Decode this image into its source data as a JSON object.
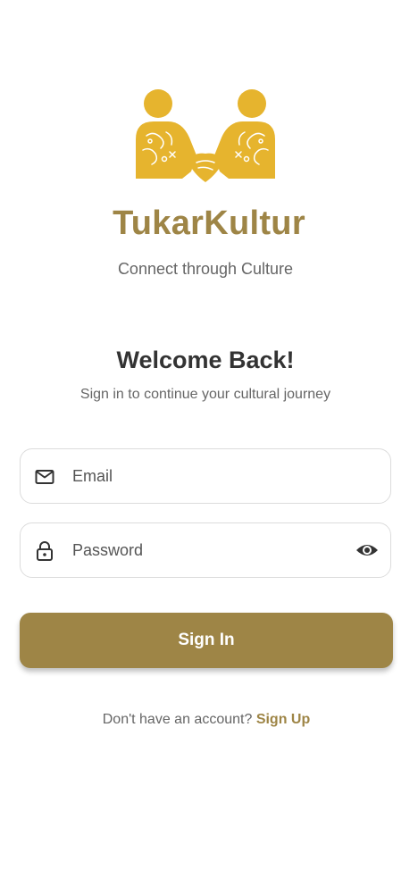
{
  "brand": {
    "name": "TukarKultur",
    "tagline": "Connect through Culture",
    "accent_color": "#9e8546",
    "logo_color": "#e6b42e"
  },
  "welcome": {
    "title": "Welcome Back!",
    "subtitle": "Sign in to continue your cultural journey"
  },
  "form": {
    "email": {
      "placeholder": "Email",
      "value": "",
      "icon": "mail-icon"
    },
    "password": {
      "placeholder": "Password",
      "value": "",
      "icon": "lock-icon",
      "toggle_icon": "eye-icon"
    },
    "submit_label": "Sign In"
  },
  "footer": {
    "prompt": "Don't have an account?",
    "link": "Sign Up"
  }
}
